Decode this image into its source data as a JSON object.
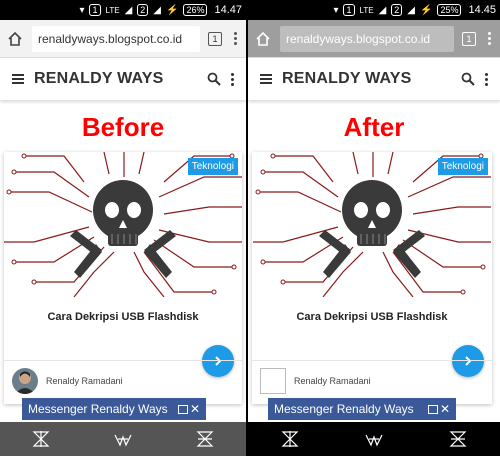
{
  "left": {
    "status": {
      "battery": "26%",
      "time": "14.47",
      "sim1": "1",
      "sim2": "2",
      "network": "LTE"
    },
    "url": "renaldyways.blogspot.co.id",
    "tab_count": "1",
    "blog_title": "RENALDY WAYS",
    "compare_label": "Before",
    "card": {
      "category": "Teknologi",
      "title": "Cara Dekripsi USB Flashdisk",
      "author": "Renaldy Ramadani"
    },
    "messenger": "Messenger Renaldy Ways"
  },
  "right": {
    "status": {
      "battery": "25%",
      "time": "14.45",
      "sim1": "1",
      "sim2": "2",
      "network": "LTE"
    },
    "url": "renaldyways.blogspot.co.id",
    "tab_count": "1",
    "blog_title": "RENALDY WAYS",
    "compare_label": "After",
    "card": {
      "category": "Teknologi",
      "title": "Cara Dekripsi USB Flashdisk",
      "author": "Renaldy Ramadani"
    },
    "messenger": "Messenger Renaldy Ways"
  },
  "colors": {
    "accent": "#1e9be6",
    "label_red": "#ff0000",
    "messenger_blue": "#3b5998",
    "circuit_red": "#8b1a1a"
  }
}
